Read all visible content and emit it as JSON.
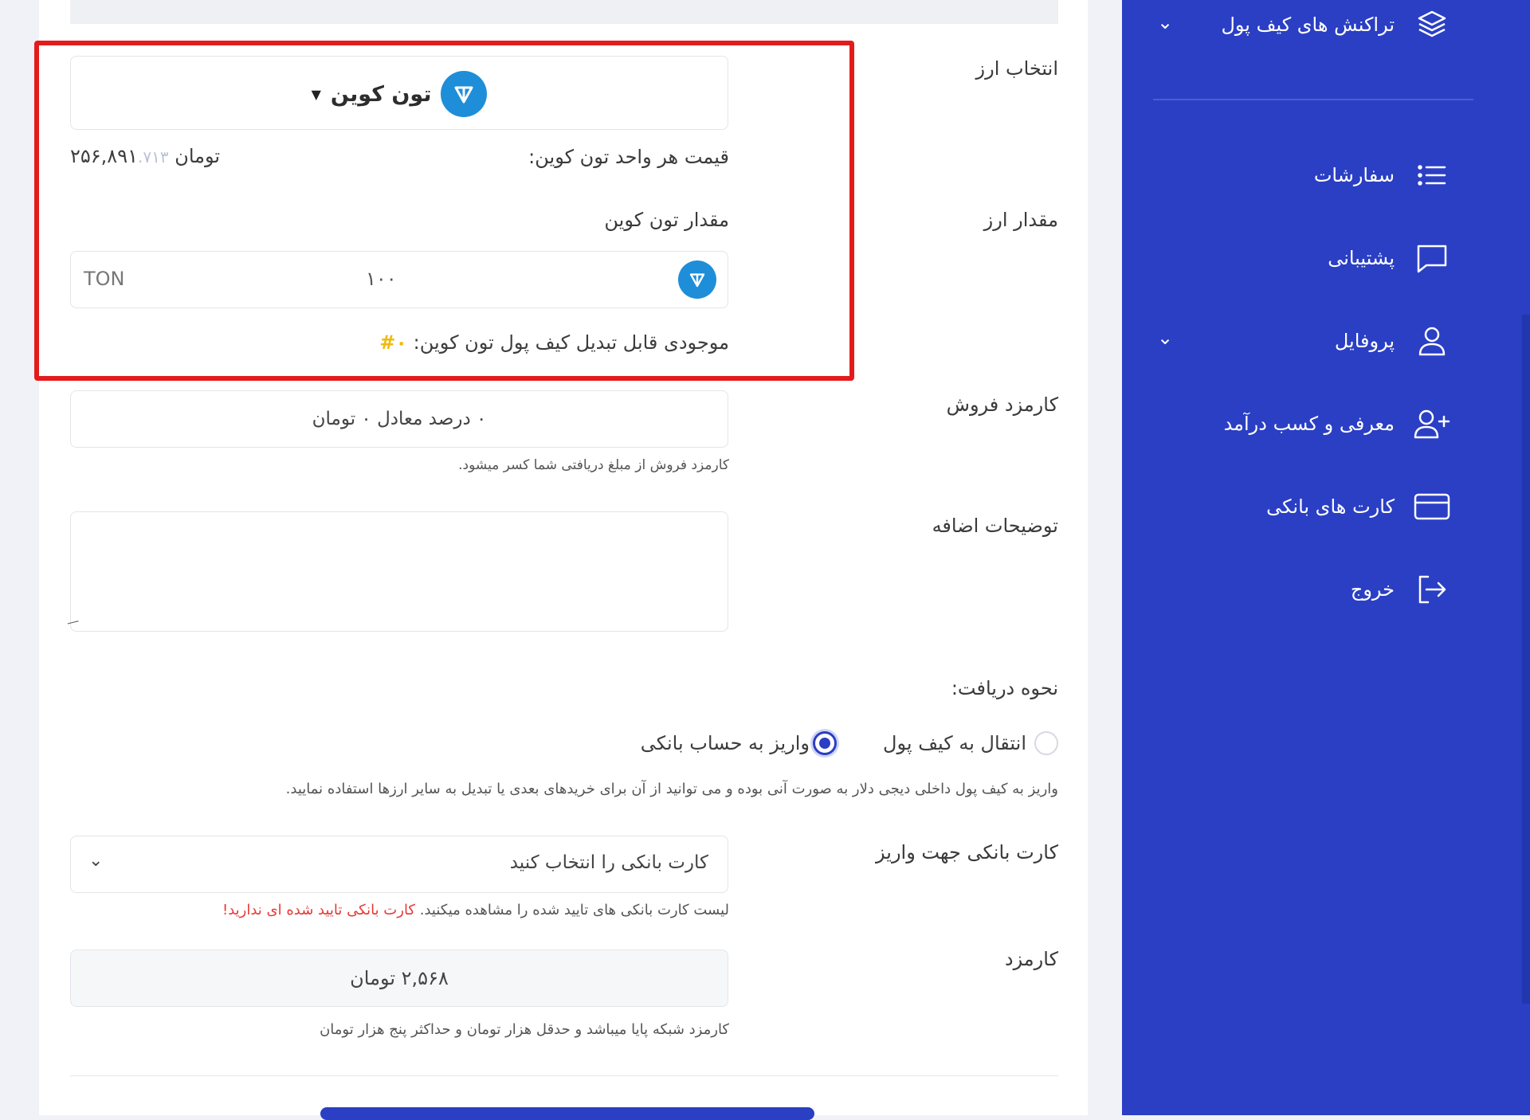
{
  "sidebar": {
    "top_item": {
      "label": "تراکنش های کیف پول"
    },
    "items": [
      {
        "label": "سفارشات"
      },
      {
        "label": "پشتیبانی"
      },
      {
        "label": "پروفایل"
      },
      {
        "label": "معرفی و کسب درآمد"
      },
      {
        "label": "کارت های بانکی"
      },
      {
        "label": "خروج"
      }
    ]
  },
  "form": {
    "currency": {
      "label": "انتخاب ارز",
      "selected": "تون کوین"
    },
    "price": {
      "label": "قیمت هر واحد تون کوین:",
      "value_main": "۲۵۶,۸۹۱",
      "value_decimal": ".۷۱۳",
      "unit": "تومان"
    },
    "amount": {
      "label": "مقدار ارز",
      "sublabel": "مقدار تون کوین",
      "value": "۱۰۰",
      "unit": "TON"
    },
    "balance": {
      "label": "موجودی قابل تبدیل کیف پول تون کوین:",
      "value": "۰#"
    },
    "sale_fee": {
      "label": "کارمزد فروش",
      "value": "۰ درصد معادل ۰ تومان",
      "help": "کارمزد فروش از مبلغ دریافتی شما کسر میشود."
    },
    "notes": {
      "label": "توضیحات اضافه",
      "value": ""
    },
    "receive": {
      "label": "نحوه دریافت:",
      "option_wallet": "انتقال به کیف پول",
      "option_bank": "واریز به حساب بانکی",
      "selected": "bank",
      "help": "واریز به کیف پول داخلی دیجی دلار به صورت آنی بوده و می توانید از آن برای خریدهای بعدی یا تبدیل به سایر ارزها استفاده نمایید."
    },
    "bank_card": {
      "label": "کارت بانکی جهت واریز",
      "placeholder": "کارت بانکی را انتخاب کنید",
      "help": "لیست کارت بانکی های تایید شده را مشاهده میکنید.",
      "warning": "کارت بانکی تایید شده ای ندارید!"
    },
    "fee": {
      "label": "کارمزد",
      "value": "۲,۵۶۸ تومان",
      "help": "کارمزد شبکه پایا میباشد و حدقل هزار تومان و حداکثر پنج هزار تومان"
    }
  },
  "colors": {
    "sidebar": "#2a3fc4",
    "highlight": "#e31b1b",
    "ton": "#1e8ed9",
    "balance_accent": "#f0b90b",
    "warning": "#e53935"
  }
}
